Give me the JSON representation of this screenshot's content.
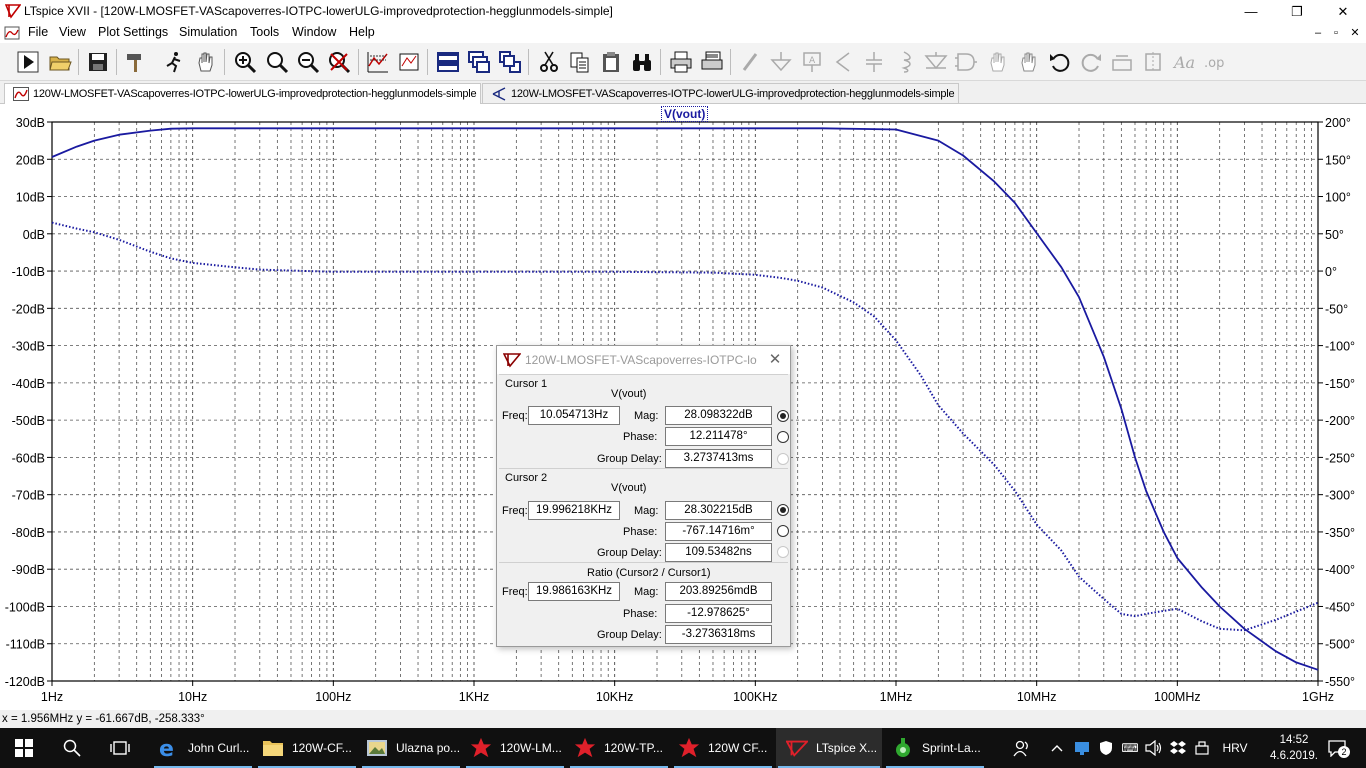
{
  "window": {
    "title": "LTspice XVII - [120W-LMOSFET-VAScapoverres-IOTPC-lowerULG-improvedprotection-hegglunmodels-simple]",
    "controls": {
      "minimize": "—",
      "restore": "❐",
      "close": "✕"
    }
  },
  "menu": {
    "items": [
      "File",
      "View",
      "Plot Settings",
      "Simulation",
      "Tools",
      "Window",
      "Help"
    ],
    "mdi_controls": {
      "minimize": "–",
      "restore": "▫",
      "close": "✕"
    }
  },
  "toolbar": {
    "buttons": [
      "run",
      "open",
      "save",
      "hammer",
      "cursor-run",
      "pan-hand",
      "zoom-in",
      "zoom-out",
      "zoom-fit",
      "zoom-cancel",
      "autorange",
      "plot-settings",
      "tile-horizontal",
      "cascade",
      "tile-vertical",
      "cut",
      "copy",
      "paste",
      "find",
      "print",
      "print-setup",
      "draw-wire",
      "ground",
      "label-net",
      "resistor",
      "capacitor",
      "inductor",
      "diode",
      "component",
      "move-hand",
      "drag-hand",
      "undo",
      "redo",
      "rotate",
      "mirror",
      "text",
      "spice-directive"
    ]
  },
  "tabs": [
    {
      "label": "120W-LMOSFET-VAScapoverres-IOTPC-lowerULG-improvedprotection-hegglunmodels-simple",
      "icon": "waveform-icon",
      "active": true
    },
    {
      "label": "120W-LMOSFET-VAScapoverres-IOTPC-lowerULG-improvedprotection-hegglunmodels-simple",
      "icon": "schematic-icon",
      "active": false
    }
  ],
  "plot": {
    "trace_label": "V(vout)",
    "trace_color": "#1a1aa0",
    "chart_data": {
      "type": "line",
      "xscale": "log",
      "xlim": [
        1,
        1000000000
      ],
      "x_ticks": [
        "1Hz",
        "10Hz",
        "100Hz",
        "1KHz",
        "10KHz",
        "100KHz",
        "1MHz",
        "10MHz",
        "100MHz",
        "1GHz"
      ],
      "y_left_ticks": [
        "30dB",
        "20dB",
        "10dB",
        "0dB",
        "-10dB",
        "-20dB",
        "-30dB",
        "-40dB",
        "-50dB",
        "-60dB",
        "-70dB",
        "-80dB",
        "-90dB",
        "-100dB",
        "-110dB",
        "-120dB"
      ],
      "ylim_left": [
        -120,
        30
      ],
      "y_right_ticks": [
        "200°",
        "150°",
        "100°",
        "50°",
        "0°",
        "-50°",
        "-100°",
        "-150°",
        "-200°",
        "-250°",
        "-300°",
        "-350°",
        "-400°",
        "-450°",
        "-500°",
        "-550°"
      ],
      "ylim_right": [
        -550,
        200
      ],
      "grid": true,
      "series": [
        {
          "name": "V(vout)",
          "style": "solid",
          "axis": "left",
          "x": [
            1,
            1.5,
            2,
            3,
            5,
            7,
            10,
            100,
            1000,
            10000,
            100000,
            300000,
            1000000,
            2000000,
            3000000,
            5000000,
            7000000,
            10000000,
            15000000,
            20000000,
            30000000,
            40000000,
            50000000,
            60000000,
            80000000,
            100000000,
            150000000,
            200000000,
            300000000,
            500000000,
            700000000,
            1000000000
          ],
          "y": [
            20.6,
            23.4,
            25,
            26.6,
            27.7,
            28.2,
            28.3,
            28.3,
            28.3,
            28.3,
            28.3,
            28.3,
            28,
            25,
            21,
            14,
            8.3,
            0.2,
            -9,
            -17,
            -33,
            -47,
            -60,
            -69,
            -80,
            -87,
            -95,
            -100,
            -106,
            -112,
            -115,
            -117
          ]
        },
        {
          "name": "V(vout)",
          "style": "dotted",
          "axis": "right",
          "x": [
            1,
            1.5,
            2,
            3,
            5,
            7,
            10,
            20,
            30,
            100,
            1000,
            10000,
            50000,
            100000,
            150000,
            200000,
            300000,
            500000,
            700000,
            1000000,
            1500000,
            2000000,
            3000000,
            5000000,
            7000000,
            10000000,
            15000000,
            20000000,
            30000000,
            40000000,
            50000000,
            60000000,
            80000000,
            100000000,
            150000000,
            200000000,
            300000000,
            500000000,
            1000000000
          ],
          "y": [
            65,
            57,
            52,
            42,
            26,
            17,
            11,
            5,
            2,
            -1,
            -1,
            -1,
            -2,
            -5,
            -9,
            -13,
            -22,
            -42,
            -61,
            -93,
            -140,
            -180,
            -218,
            -260,
            -295,
            -340,
            -375,
            -410,
            -440,
            -460,
            -463,
            -460,
            -456,
            -453,
            -470,
            -480,
            -482,
            -468,
            -445
          ]
        }
      ]
    }
  },
  "status": {
    "readout": "x = 1.956MHz    y = -61.667dB, -258.333°"
  },
  "cursor_dialog": {
    "title": "120W-LMOSFET-VAScapoverres-IOTPC-lo...",
    "close": "✕",
    "cursor1": {
      "heading": "Cursor 1",
      "trace": "V(vout)",
      "freq_label": "Freq:",
      "freq": "10.054713Hz",
      "mag_label": "Mag:",
      "mag": "28.098322dB",
      "phase_label": "Phase:",
      "phase": "12.211478°",
      "gd_label": "Group Delay:",
      "gd": "3.2737413ms"
    },
    "cursor2": {
      "heading": "Cursor 2",
      "trace": "V(vout)",
      "freq_label": "Freq:",
      "freq": "19.996218KHz",
      "mag_label": "Mag:",
      "mag": "28.302215dB",
      "phase_label": "Phase:",
      "phase": "-767.14716m°",
      "gd_label": "Group Delay:",
      "gd": "109.53482ns"
    },
    "ratio": {
      "heading": "Ratio (Cursor2 / Cursor1)",
      "freq_label": "Freq:",
      "freq": "19.986163KHz",
      "mag_label": "Mag:",
      "mag": "203.89256mdB",
      "phase_label": "Phase:",
      "phase": "-12.978625°",
      "gd_label": "Group Delay:",
      "gd": "-3.2736318ms"
    }
  },
  "taskbar": {
    "items": [
      {
        "label": "John Curl...",
        "icon": "edge-icon",
        "open": true
      },
      {
        "label": "120W-CF...",
        "icon": "folder-icon",
        "open": true
      },
      {
        "label": "Ulazna po...",
        "icon": "viewer-icon",
        "open": true
      },
      {
        "label": "120W-LM...",
        "icon": "ltspice-red-icon",
        "open": true
      },
      {
        "label": "120W-TP...",
        "icon": "ltspice-red-icon",
        "open": true
      },
      {
        "label": "120W CF...",
        "icon": "ltspice-red-icon",
        "open": true
      },
      {
        "label": "LTspice X...",
        "icon": "ltspice-icon",
        "open": true,
        "active": true
      },
      {
        "label": "Sprint-La...",
        "icon": "sprint-icon",
        "open": true
      }
    ],
    "language": "HRV",
    "time": "14:52",
    "date": "4.6.2019.",
    "notifications": "2"
  }
}
